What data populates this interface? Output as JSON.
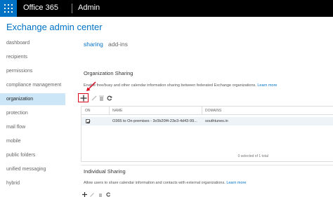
{
  "topbar": {
    "brand": "Office 365",
    "section": "Admin"
  },
  "app_title": "Exchange admin center",
  "nav": {
    "items": [
      {
        "label": "dashboard"
      },
      {
        "label": "recipients"
      },
      {
        "label": "permissions"
      },
      {
        "label": "compliance management"
      },
      {
        "label": "organization",
        "active": true
      },
      {
        "label": "protection"
      },
      {
        "label": "mail flow"
      },
      {
        "label": "mobile"
      },
      {
        "label": "public folders"
      },
      {
        "label": "unified messaging"
      },
      {
        "label": "hybrid"
      }
    ]
  },
  "tabs": [
    {
      "label": "sharing",
      "active": true
    },
    {
      "label": "add-ins"
    }
  ],
  "org_sharing": {
    "title": "Organization Sharing",
    "description": "Enable free/busy and other calendar information sharing between federated Exchange organizations.",
    "learn_more": "Learn more",
    "toolbar": [
      "add-icon",
      "edit-icon",
      "delete-icon",
      "refresh-icon"
    ],
    "table": {
      "columns": [
        "ON",
        "NAME",
        "DOMAINS"
      ],
      "rows": [
        {
          "on": true,
          "name": "O365 to On-premises - 3c0b20f4-23e3-4d43-99...",
          "domains": "southtunes.in"
        }
      ],
      "selection_status": "0 selected of 1 total"
    }
  },
  "individual_sharing": {
    "title": "Individual Sharing",
    "description": "Allow users to share calendar information and contacts with external organizations.",
    "learn_more": "Learn more"
  },
  "colors": {
    "accent": "#0072c6",
    "highlight": "#d9001b",
    "nav_active": "#cde6f7"
  }
}
